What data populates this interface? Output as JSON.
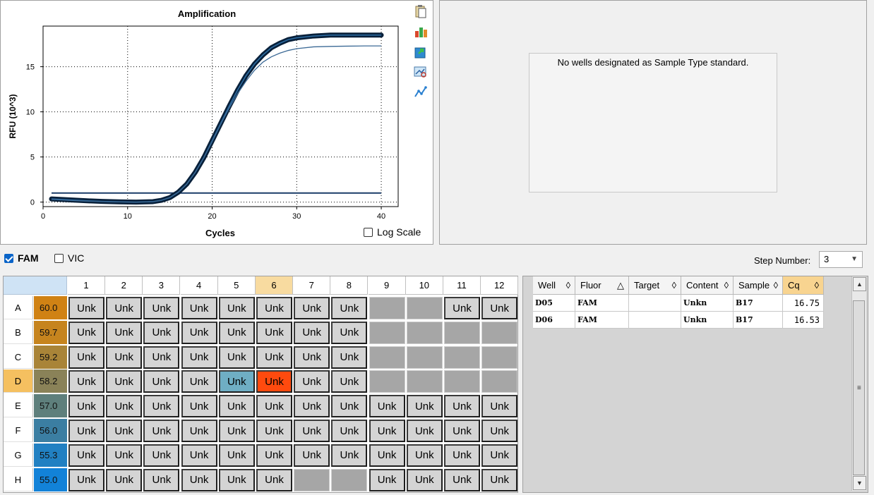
{
  "chart": {
    "title": "Amplification",
    "xlabel": "Cycles",
    "ylabel": "RFU (10^3)",
    "log_scale_label": "Log Scale"
  },
  "chart_data": {
    "type": "line",
    "title": "Amplification",
    "xlabel": "Cycles",
    "ylabel": "RFU (10^3)",
    "xlim": [
      0,
      42
    ],
    "ylim": [
      -0.5,
      19.5
    ],
    "xticks": [
      0,
      10,
      20,
      30,
      40
    ],
    "yticks": [
      0,
      5,
      10,
      15
    ],
    "grid": true,
    "threshold": 1.0,
    "series": [
      {
        "color": "#08203a",
        "x": [
          1,
          3,
          5,
          7,
          9,
          11,
          13,
          14,
          15,
          16,
          17,
          18,
          19,
          20,
          21,
          22,
          23,
          24,
          25,
          26,
          27,
          28,
          29,
          30,
          32,
          34,
          36,
          38,
          40
        ],
        "values": [
          0.35,
          0.25,
          0.15,
          0.08,
          0.03,
          0.0,
          0.05,
          0.2,
          0.5,
          1.1,
          2.0,
          3.3,
          4.9,
          6.8,
          8.7,
          10.6,
          12.4,
          14.0,
          15.3,
          16.3,
          17.1,
          17.6,
          18.0,
          18.2,
          18.4,
          18.5,
          18.5,
          18.5,
          18.5
        ]
      },
      {
        "color": "#3c6a96",
        "x": [
          1,
          3,
          5,
          7,
          9,
          11,
          13,
          14,
          15,
          16,
          17,
          18,
          19,
          20,
          21,
          22,
          23,
          24,
          25,
          26,
          27,
          28,
          29,
          30,
          32,
          34,
          36,
          38,
          40
        ],
        "values": [
          0.3,
          0.2,
          0.12,
          0.06,
          0.02,
          0.0,
          0.05,
          0.2,
          0.5,
          1.1,
          2.0,
          3.3,
          4.9,
          6.7,
          8.6,
          10.4,
          12.0,
          13.4,
          14.6,
          15.5,
          16.1,
          16.5,
          16.8,
          17.0,
          17.2,
          17.25,
          17.28,
          17.3,
          17.3
        ]
      }
    ]
  },
  "standard_curve": {
    "message": "No wells designated as Sample Type standard."
  },
  "fluors": [
    {
      "label": "FAM",
      "checked": true
    },
    {
      "label": "VIC",
      "checked": false
    }
  ],
  "step": {
    "label": "Step Number:",
    "value": "3"
  },
  "plate": {
    "columns": [
      "1",
      "2",
      "3",
      "4",
      "5",
      "6",
      "7",
      "8",
      "9",
      "10",
      "11",
      "12"
    ],
    "rows": [
      {
        "label": "A",
        "temp": "60.0",
        "temp_color": "#d08214",
        "wells": [
          "Unk",
          "Unk",
          "Unk",
          "Unk",
          "Unk",
          "Unk",
          "Unk",
          "Unk",
          "",
          "",
          "Unk",
          "Unk"
        ]
      },
      {
        "label": "B",
        "temp": "59.7",
        "temp_color": "#c6841e",
        "wells": [
          "Unk",
          "Unk",
          "Unk",
          "Unk",
          "Unk",
          "Unk",
          "Unk",
          "Unk",
          "",
          "",
          "",
          ""
        ]
      },
      {
        "label": "C",
        "temp": "59.2",
        "temp_color": "#a98438",
        "wells": [
          "Unk",
          "Unk",
          "Unk",
          "Unk",
          "Unk",
          "Unk",
          "Unk",
          "Unk",
          "",
          "",
          "",
          ""
        ]
      },
      {
        "label": "D",
        "temp": "58.2",
        "temp_color": "#8a8258",
        "wells": [
          "Unk",
          "Unk",
          "Unk",
          "Unk",
          "Unk",
          "Unk",
          "Unk",
          "Unk",
          "",
          "",
          "",
          ""
        ]
      },
      {
        "label": "E",
        "temp": "57.0",
        "temp_color": "#5e7f7c",
        "wells": [
          "Unk",
          "Unk",
          "Unk",
          "Unk",
          "Unk",
          "Unk",
          "Unk",
          "Unk",
          "Unk",
          "Unk",
          "Unk",
          "Unk"
        ]
      },
      {
        "label": "F",
        "temp": "56.0",
        "temp_color": "#3b7ea2",
        "wells": [
          "Unk",
          "Unk",
          "Unk",
          "Unk",
          "Unk",
          "Unk",
          "Unk",
          "Unk",
          "Unk",
          "Unk",
          "Unk",
          "Unk"
        ]
      },
      {
        "label": "G",
        "temp": "55.3",
        "temp_color": "#2180c2",
        "wells": [
          "Unk",
          "Unk",
          "Unk",
          "Unk",
          "Unk",
          "Unk",
          "Unk",
          "Unk",
          "Unk",
          "Unk",
          "Unk",
          "Unk"
        ]
      },
      {
        "label": "H",
        "temp": "55.0",
        "temp_color": "#1282d8",
        "wells": [
          "Unk",
          "Unk",
          "Unk",
          "Unk",
          "Unk",
          "Unk",
          "",
          "",
          "Unk",
          "Unk",
          "Unk",
          "Unk"
        ]
      }
    ],
    "highlight_row": "D",
    "highlight_col": "6",
    "special_wells": [
      {
        "row": "D",
        "col": "5",
        "color": "#6faec4"
      },
      {
        "row": "D",
        "col": "6",
        "color": "#ff4a0e"
      }
    ]
  },
  "results_table": {
    "columns": [
      {
        "label": "Well",
        "sort": "◊"
      },
      {
        "label": "Fluor",
        "sort": "△"
      },
      {
        "label": "Target",
        "sort": "◊"
      },
      {
        "label": "Content",
        "sort": "◊"
      },
      {
        "label": "Sample",
        "sort": "◊"
      },
      {
        "label": "Cq",
        "sort": "◊"
      }
    ],
    "rows": [
      [
        "D05",
        "FAM",
        "",
        "Unkn",
        "B17",
        "16.75"
      ],
      [
        "D06",
        "FAM",
        "",
        "Unkn",
        "B17",
        "16.53"
      ]
    ]
  },
  "colors": {
    "highlight_header": "#f5c060",
    "sorted_header": "#f8d490"
  }
}
